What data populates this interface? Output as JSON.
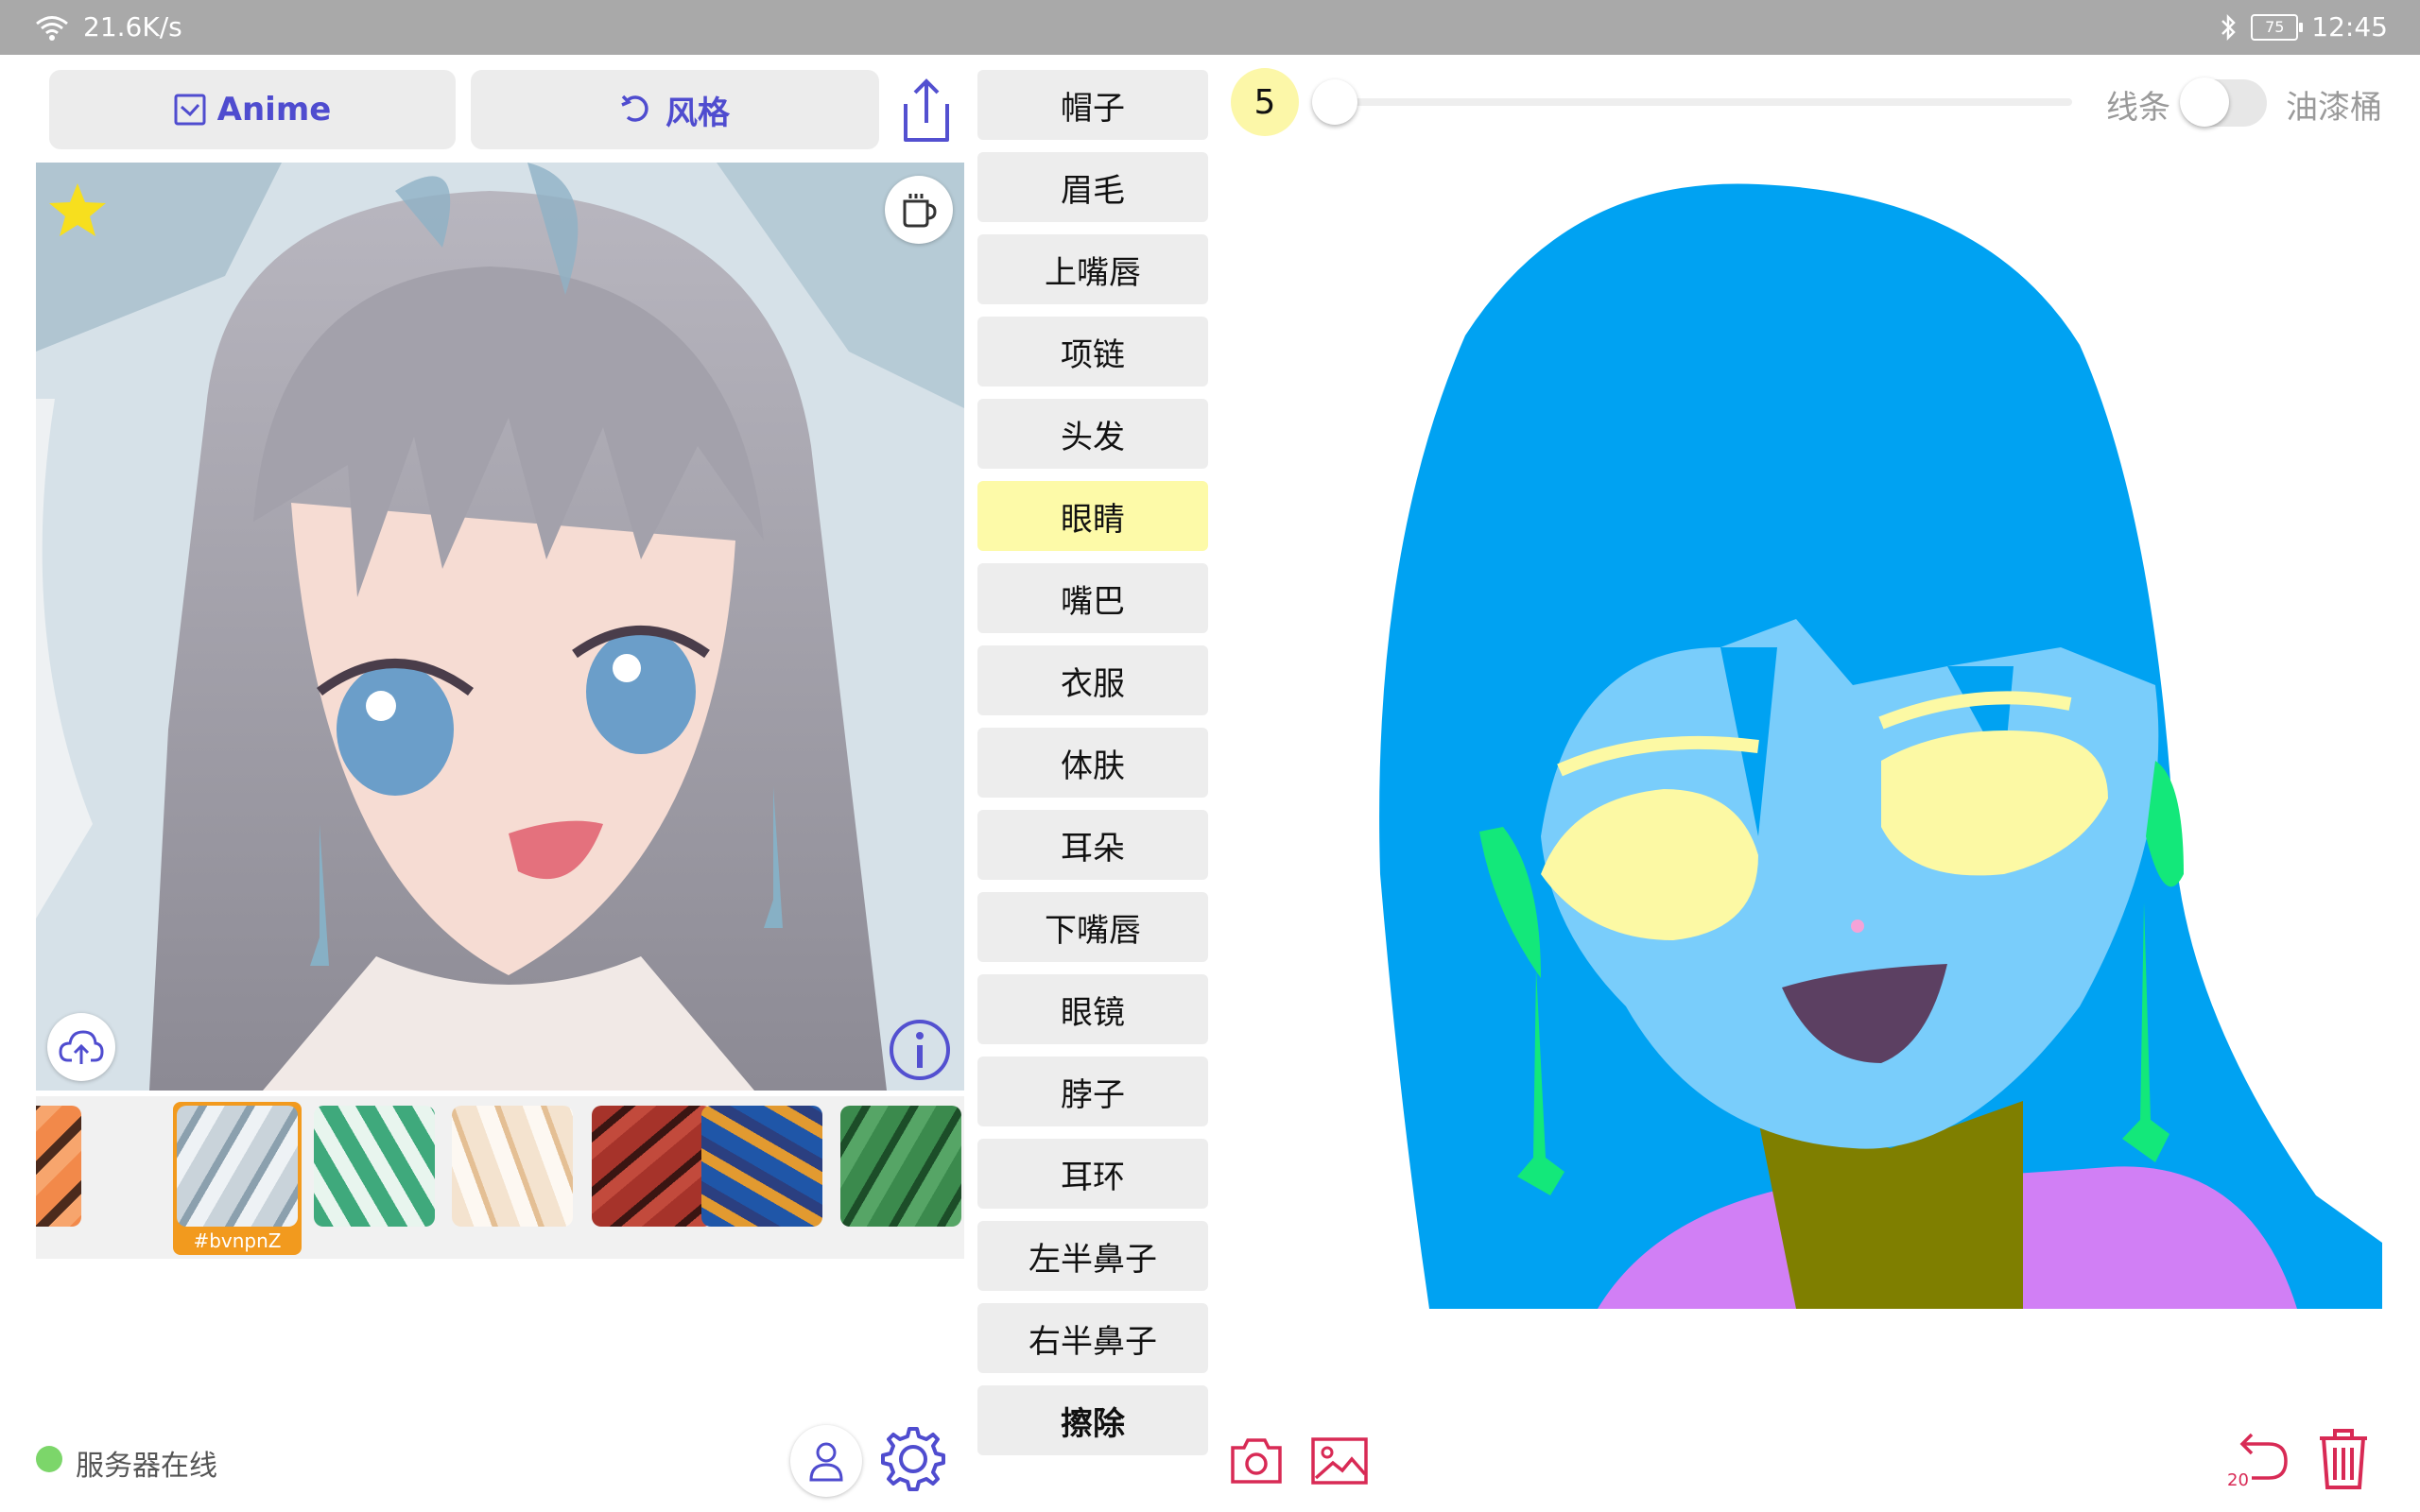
{
  "status_bar": {
    "network_speed": "21.6K/s",
    "battery": "75",
    "time": "12:45"
  },
  "toolbar": {
    "anime_label": "Anime",
    "style_label": "风格"
  },
  "style_strip": {
    "selected_tag": "#bvnpnZ"
  },
  "labels": [
    {
      "label": "帽子"
    },
    {
      "label": "眉毛"
    },
    {
      "label": "上嘴唇"
    },
    {
      "label": "项链"
    },
    {
      "label": "头发"
    },
    {
      "label": "眼睛"
    },
    {
      "label": "嘴巴"
    },
    {
      "label": "衣服"
    },
    {
      "label": "体肤"
    },
    {
      "label": "耳朵"
    },
    {
      "label": "下嘴唇"
    },
    {
      "label": "眼镜"
    },
    {
      "label": "脖子"
    },
    {
      "label": "耳环"
    },
    {
      "label": "左半鼻子"
    },
    {
      "label": "右半鼻子"
    },
    {
      "label": "擦除"
    }
  ],
  "active_label": "眼睛",
  "brush": {
    "size": "5"
  },
  "mode_toggle": {
    "left_label": "线条",
    "right_label": "油漆桶"
  },
  "server_status": "服务器在线",
  "undo": {
    "count": "20"
  },
  "colors": {
    "accent": "#4f4ccf",
    "active_label": "#fdfaa8",
    "hair": "#00a2f2",
    "skin": "#79cdfb",
    "eyes": "#fcf9a4",
    "mouth": "#5c4062",
    "neck": "#7f7f00",
    "clothes": "#d17ff5",
    "earrings": "#13e87a",
    "danger": "#d82a55"
  }
}
